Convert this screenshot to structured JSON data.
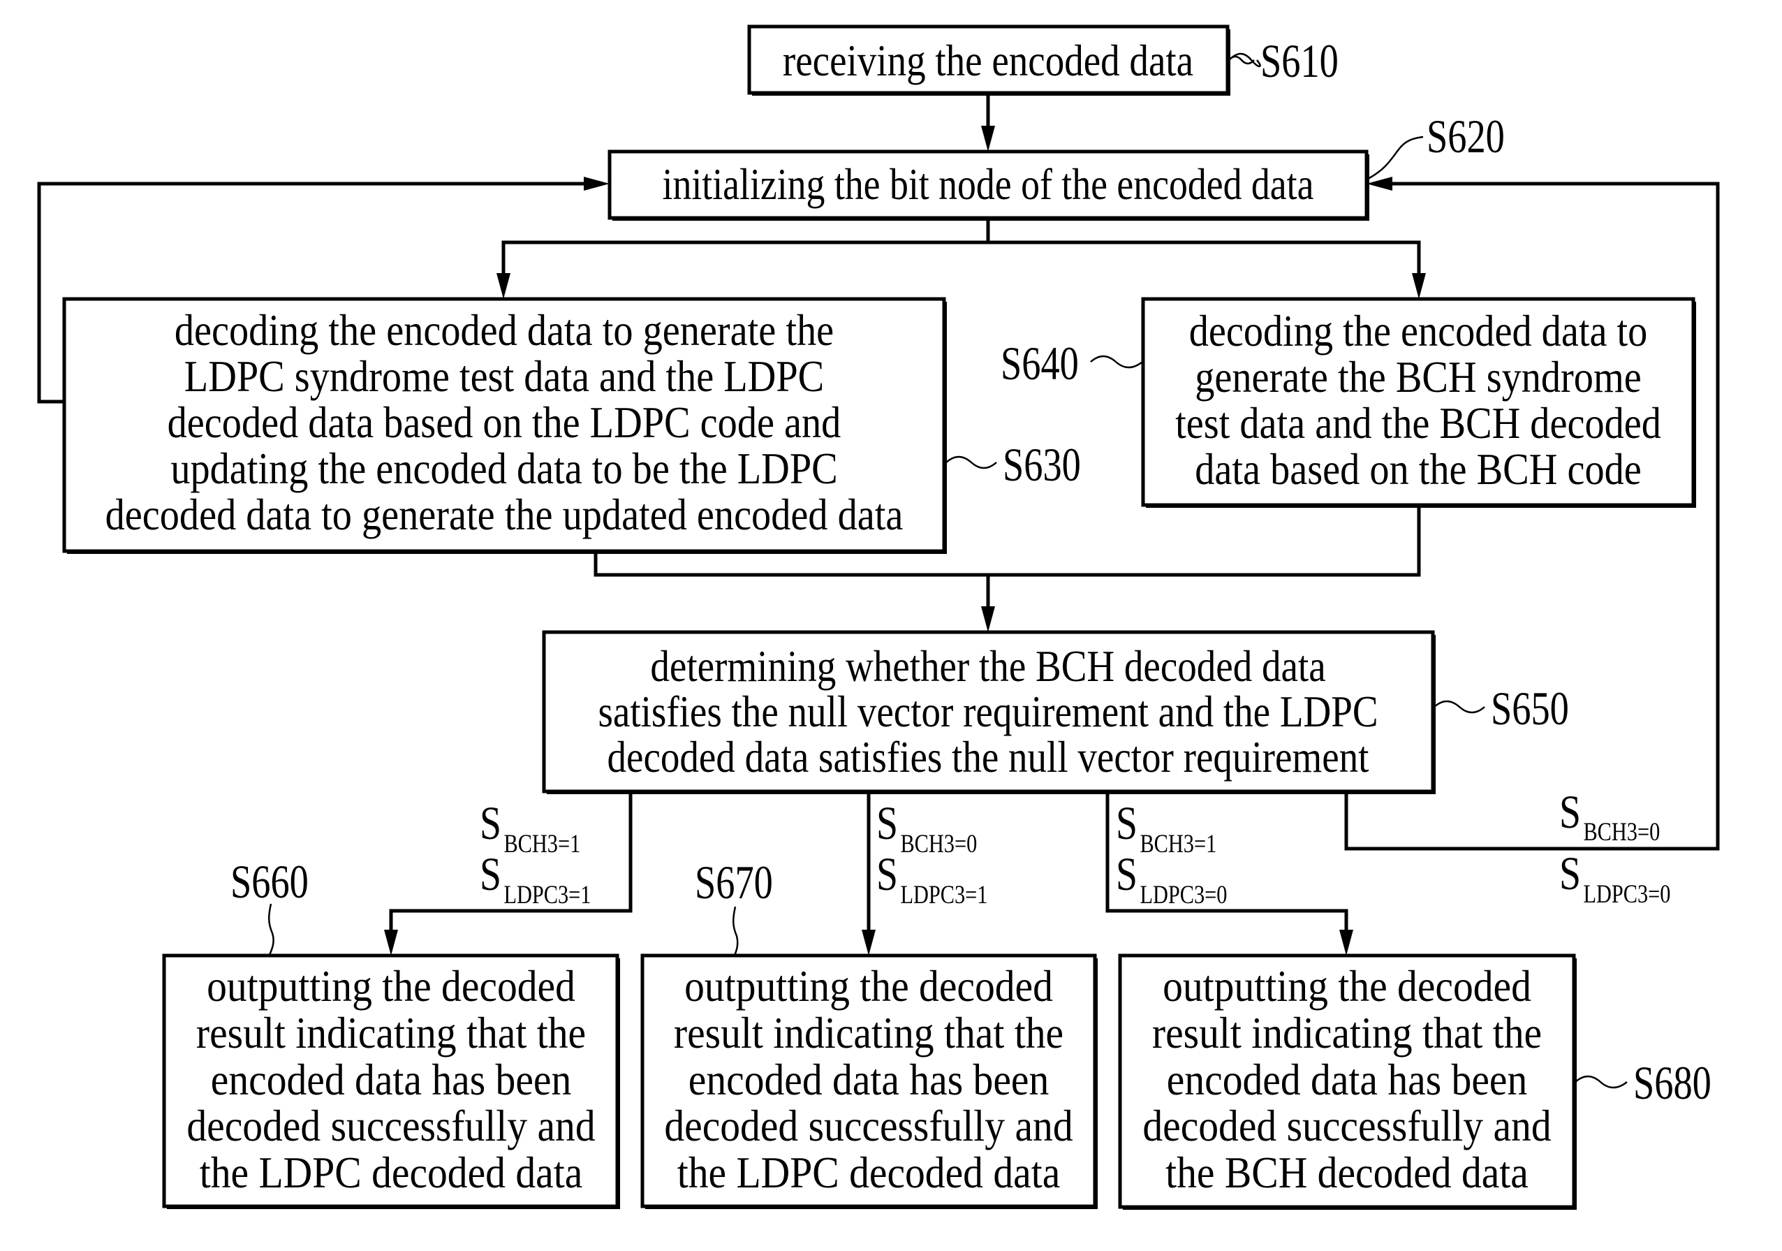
{
  "diagram": {
    "steps": {
      "s610": {
        "id": "S610",
        "lines": [
          "receiving the encoded data"
        ]
      },
      "s620": {
        "id": "S620",
        "lines": [
          "initializing the bit node of the encoded data"
        ]
      },
      "s630": {
        "id": "S630",
        "lines": [
          "decoding the encoded data to generate the",
          "LDPC syndrome test data and the LDPC",
          "decoded data based on the LDPC code and",
          "updating the encoded data to be the LDPC",
          "decoded data to generate the updated encoded data"
        ]
      },
      "s640": {
        "id": "S640",
        "lines": [
          "decoding the encoded data to",
          "generate the BCH syndrome",
          "test data and the BCH decoded",
          "data based on the BCH code"
        ]
      },
      "s650": {
        "id": "S650",
        "lines": [
          "determining whether the BCH decoded data",
          "satisfies the null vector requirement and the LDPC",
          "decoded data satisfies the null vector requirement"
        ]
      },
      "s660": {
        "id": "S660",
        "lines": [
          "outputting the decoded",
          "result indicating that the",
          "encoded data has been",
          "decoded successfully and",
          "the LDPC decoded data"
        ]
      },
      "s670": {
        "id": "S670",
        "lines": [
          "outputting the decoded",
          "result indicating that the",
          "encoded data has been",
          "decoded successfully and",
          "the LDPC decoded data"
        ]
      },
      "s680": {
        "id": "S680",
        "lines": [
          "outputting the decoded",
          "result indicating that the",
          "encoded data has been",
          "decoded successfully and",
          "the BCH decoded data"
        ]
      }
    },
    "conditions": [
      {
        "target": "S660",
        "symbol": "S",
        "bch": "BCH3=1",
        "ldpc": "LDPC3=1"
      },
      {
        "target": "S670",
        "symbol": "S",
        "bch": "BCH3=0",
        "ldpc": "LDPC3=1"
      },
      {
        "target": "S680",
        "symbol": "S",
        "bch": "BCH3=1",
        "ldpc": "LDPC3=0"
      },
      {
        "target": "S620",
        "symbol": "S",
        "bch": "BCH3=0",
        "ldpc": "LDPC3=0"
      }
    ]
  }
}
